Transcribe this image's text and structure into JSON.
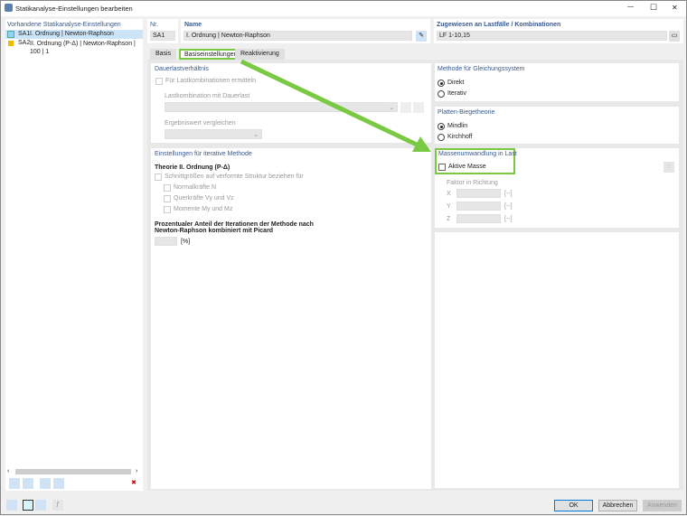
{
  "window": {
    "title": "Statikanalyse-Einstellungen bearbeiten",
    "minimize": "—",
    "maximize": "☐",
    "close": "✕"
  },
  "sidebar": {
    "header": "Vorhandene Statikanalyse-Einstellungen",
    "items": [
      {
        "id": "SA1",
        "label": "I. Ordnung | Newton-Raphson",
        "color": "#8fd3f5",
        "selected": true
      },
      {
        "id": "SA2",
        "label": "II. Ordnung (P-Δ) | Newton-Raphson | 100 | 1",
        "color": "#f5b800",
        "selected": false
      }
    ],
    "delete_icon": "✖"
  },
  "nr": {
    "label": "Nr.",
    "value": "SA1"
  },
  "name": {
    "label": "Name",
    "value": "I. Ordnung | Newton-Raphson"
  },
  "assigned": {
    "label": "Zugewiesen an Lastfälle / Kombinationen",
    "value": "LF 1-10,15"
  },
  "tabs": [
    {
      "label": "Basis"
    },
    {
      "label": "Basiseinstellungen",
      "active": true
    },
    {
      "label": "Reaktivierung"
    }
  ],
  "dauerlast": {
    "title": "Dauerlastverhältnis",
    "checkbox": "Für Lastkombinationen ermitteln",
    "combo_label": "Lastkombination mit Dauerlast",
    "compare_label": "Ergebniswert vergleichen"
  },
  "iterative": {
    "title": "Einstellungen für iterative Methode",
    "theory": "Theorie II. Ordnung (P-Δ)",
    "refer": "Schnittgrößen auf verformte Struktur beziehen für",
    "normal": "Normalkräfte N",
    "shear": "Querkräfte Vy und Vz",
    "moment": "Momente My und Mz",
    "percent_line1": "Prozentualer Anteil der Iterationen der Methode nach",
    "percent_line2": "Newton-Raphson kombiniert mit Picard",
    "unit": "[%]"
  },
  "method": {
    "title": "Methode für Gleichungssystem",
    "options": [
      "Direkt",
      "Iterativ"
    ],
    "selected": "Direkt"
  },
  "plate": {
    "title": "Platten-Biegetheorie",
    "options": [
      "Mindlin",
      "Kirchhoff"
    ],
    "selected": "Mindlin"
  },
  "mass": {
    "title": "Massenumwandlung in Last",
    "checkbox": "Aktive Masse",
    "checked": false,
    "factor_label": "Faktor in Richtung",
    "axes": [
      "X",
      "Y",
      "Z"
    ],
    "unit": "[--]"
  },
  "buttons": {
    "ok": "OK",
    "cancel": "Abbrechen",
    "apply": "Anwenden"
  },
  "highlight_color": "#7ac943"
}
